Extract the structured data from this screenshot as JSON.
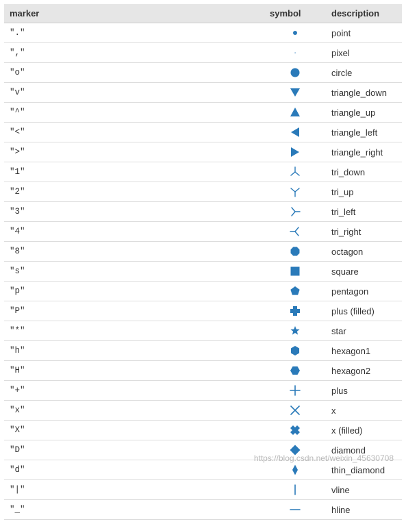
{
  "headers": {
    "marker": "marker",
    "symbol": "symbol",
    "description": "description"
  },
  "colors": {
    "accent": "#2a7ab9"
  },
  "rows": [
    {
      "marker": "\".\"",
      "icon": "point-icon",
      "description": "point"
    },
    {
      "marker": "\",\"",
      "icon": "pixel-icon",
      "description": "pixel"
    },
    {
      "marker": "\"o\"",
      "icon": "circle-icon",
      "description": "circle"
    },
    {
      "marker": "\"v\"",
      "icon": "triangle-down-icon",
      "description": "triangle_down"
    },
    {
      "marker": "\"^\"",
      "icon": "triangle-up-icon",
      "description": "triangle_up"
    },
    {
      "marker": "\"<\"",
      "icon": "triangle-left-icon",
      "description": "triangle_left"
    },
    {
      "marker": "\">\"",
      "icon": "triangle-right-icon",
      "description": "triangle_right"
    },
    {
      "marker": "\"1\"",
      "icon": "tri-down-icon",
      "description": "tri_down"
    },
    {
      "marker": "\"2\"",
      "icon": "tri-up-icon",
      "description": "tri_up"
    },
    {
      "marker": "\"3\"",
      "icon": "tri-left-icon",
      "description": "tri_left"
    },
    {
      "marker": "\"4\"",
      "icon": "tri-right-icon",
      "description": "tri_right"
    },
    {
      "marker": "\"8\"",
      "icon": "octagon-icon",
      "description": "octagon"
    },
    {
      "marker": "\"s\"",
      "icon": "square-icon",
      "description": "square"
    },
    {
      "marker": "\"p\"",
      "icon": "pentagon-icon",
      "description": "pentagon"
    },
    {
      "marker": "\"P\"",
      "icon": "plus-filled-icon",
      "description": "plus (filled)"
    },
    {
      "marker": "\"*\"",
      "icon": "star-icon",
      "description": "star"
    },
    {
      "marker": "\"h\"",
      "icon": "hexagon1-icon",
      "description": "hexagon1"
    },
    {
      "marker": "\"H\"",
      "icon": "hexagon2-icon",
      "description": "hexagon2"
    },
    {
      "marker": "\"+\"",
      "icon": "plus-icon",
      "description": "plus"
    },
    {
      "marker": "\"x\"",
      "icon": "x-icon",
      "description": "x"
    },
    {
      "marker": "\"X\"",
      "icon": "x-filled-icon",
      "description": "x (filled)"
    },
    {
      "marker": "\"D\"",
      "icon": "diamond-icon",
      "description": "diamond"
    },
    {
      "marker": "\"d\"",
      "icon": "thin-diamond-icon",
      "description": "thin_diamond"
    },
    {
      "marker": "\"|\"",
      "icon": "vline-icon",
      "description": "vline"
    },
    {
      "marker": "\"_\"",
      "icon": "hline-icon",
      "description": "hline"
    }
  ],
  "watermark": "https://blog.csdn.net/weixin_45630708"
}
